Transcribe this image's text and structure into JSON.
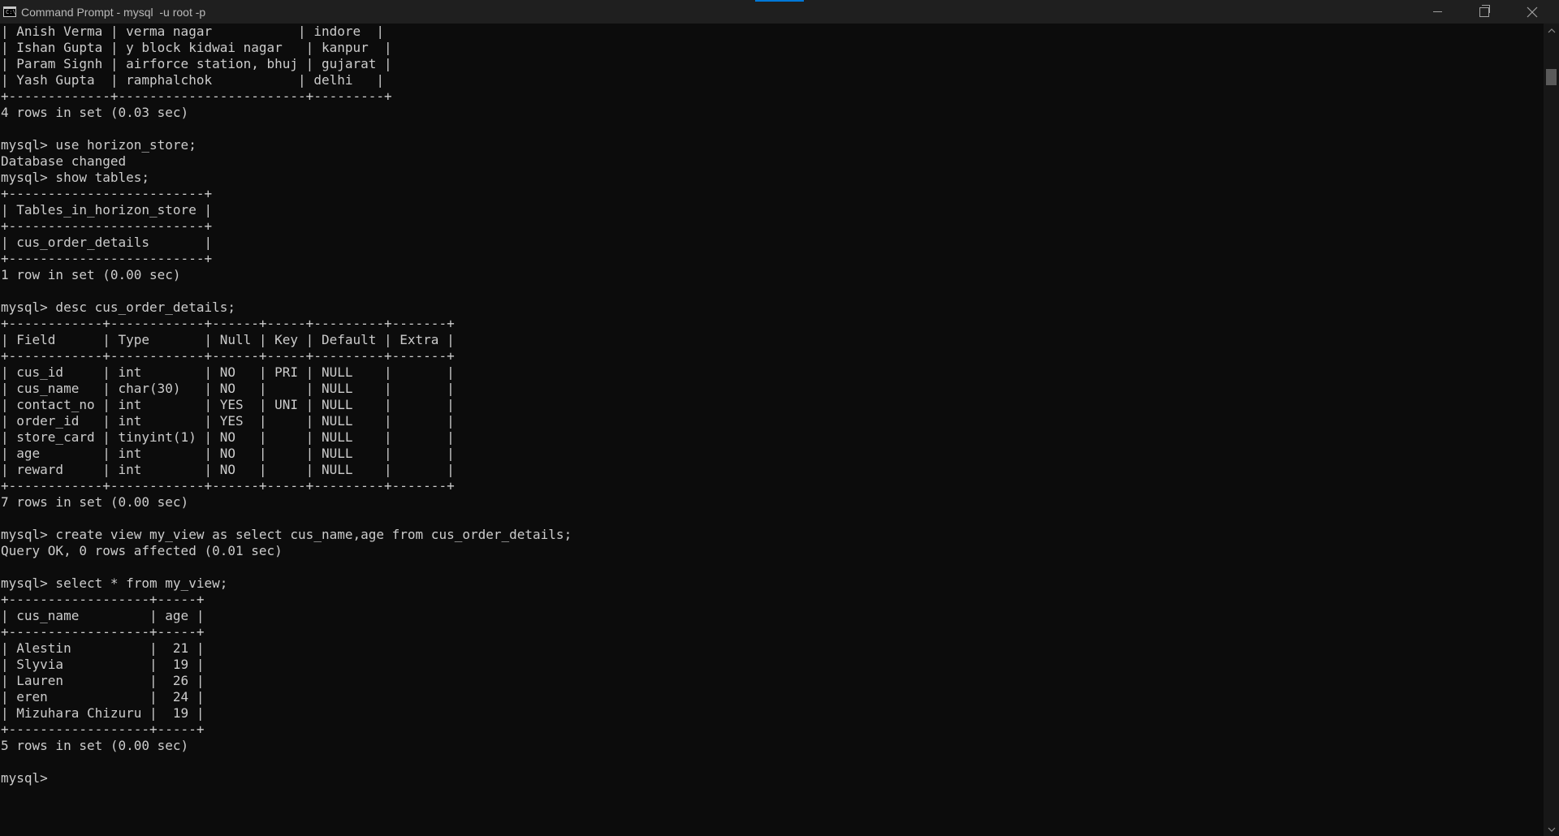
{
  "window": {
    "title": "Command Prompt - mysql  -u root -p",
    "icon_label": "C:\\",
    "minimize_icon": "minimize-icon",
    "maximize_icon": "restore-icon",
    "close_icon": "close-icon"
  },
  "console": {
    "lines": [
      "| Anish Verma | verma nagar           | indore  |",
      "| Ishan Gupta | y block kidwai nagar   | kanpur  |",
      "| Param Signh | airforce station, bhuj | gujarat |",
      "| Yash Gupta  | ramphalchok           | delhi   |",
      "+-------------+------------------------+---------+",
      "4 rows in set (0.03 sec)",
      "",
      "mysql> use horizon_store;",
      "Database changed",
      "mysql> show tables;",
      "+-------------------------+",
      "| Tables_in_horizon_store |",
      "+-------------------------+",
      "| cus_order_details       |",
      "+-------------------------+",
      "1 row in set (0.00 sec)",
      "",
      "mysql> desc cus_order_details;",
      "+------------+------------+------+-----+---------+-------+",
      "| Field      | Type       | Null | Key | Default | Extra |",
      "+------------+------------+------+-----+---------+-------+",
      "| cus_id     | int        | NO   | PRI | NULL    |       |",
      "| cus_name   | char(30)   | NO   |     | NULL    |       |",
      "| contact_no | int        | YES  | UNI | NULL    |       |",
      "| order_id   | int        | YES  |     | NULL    |       |",
      "| store_card | tinyint(1) | NO   |     | NULL    |       |",
      "| age        | int        | NO   |     | NULL    |       |",
      "| reward     | int        | NO   |     | NULL    |       |",
      "+------------+------------+------+-----+---------+-------+",
      "7 rows in set (0.00 sec)",
      "",
      "mysql> create view my_view as select cus_name,age from cus_order_details;",
      "Query OK, 0 rows affected (0.01 sec)",
      "",
      "mysql> select * from my_view;",
      "+------------------+-----+",
      "| cus_name         | age |",
      "+------------------+-----+",
      "| Alestin          |  21 |",
      "| Slyvia           |  19 |",
      "| Lauren           |  26 |",
      "| eren             |  24 |",
      "| Mizuhara Chizuru |  19 |",
      "+------------------+-----+",
      "5 rows in set (0.00 sec)",
      "",
      "mysql> "
    ]
  },
  "scrollbar": {
    "up_icon": "scroll-up-icon",
    "down_icon": "scroll-down-icon"
  }
}
